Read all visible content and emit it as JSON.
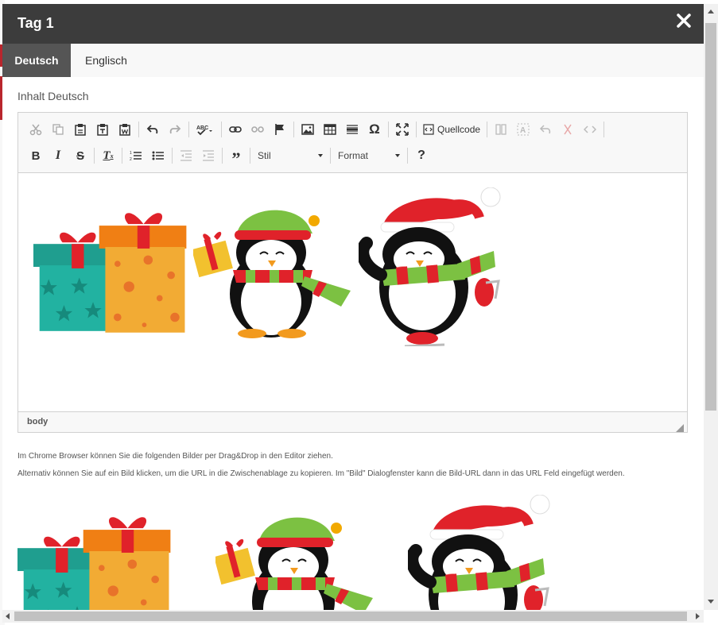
{
  "dialog": {
    "title": "Tag 1",
    "close_icon": "close-icon"
  },
  "tabs": [
    {
      "label": "Deutsch",
      "active": true
    },
    {
      "label": "Englisch",
      "active": false
    }
  ],
  "field": {
    "label": "Inhalt Deutsch"
  },
  "toolbar": {
    "row1": [
      "cut-icon",
      "copy-icon",
      "paste-icon",
      "paste-text-icon",
      "paste-from-word-icon",
      "undo-icon",
      "redo-icon",
      "spellcheck-icon",
      "link-icon",
      "unlink-icon",
      "anchor-icon",
      "image-icon",
      "table-icon",
      "horizontal-rule-icon",
      "special-char-icon",
      "maximize-icon"
    ],
    "source_label": "Quellcode",
    "row1_disabled": [
      "show-blocks-icon",
      "text-select-icon",
      "undo-box-icon",
      "remove-format-link-icon",
      "code-icon"
    ],
    "row2": [
      "bold-icon",
      "italic-icon",
      "strike-icon",
      "remove-format-icon",
      "numbered-list-icon",
      "bulleted-list-icon",
      "outdent-icon",
      "indent-icon",
      "blockquote-icon"
    ],
    "style_label": "Stil",
    "format_label": "Format",
    "help_label": "?"
  },
  "pathbar": {
    "path": "body"
  },
  "hints": {
    "line1": "Im Chrome Browser können Sie die folgenden Bilder per Drag&Drop in den Editor ziehen.",
    "line2": "Alternativ können Sie auf ein Bild klicken, um die URL in die Zwischenablage zu kopieren. Im \"Bild\" Dialogfenster kann die Bild-URL dann in das URL Feld eingefügt werden."
  },
  "images": [
    "christmas-gifts",
    "penguin-with-gift",
    "penguin-skating"
  ],
  "colors": {
    "titlebar": "#3c3c3c",
    "active_tab": "#555555",
    "accent_red": "#b9262d"
  }
}
